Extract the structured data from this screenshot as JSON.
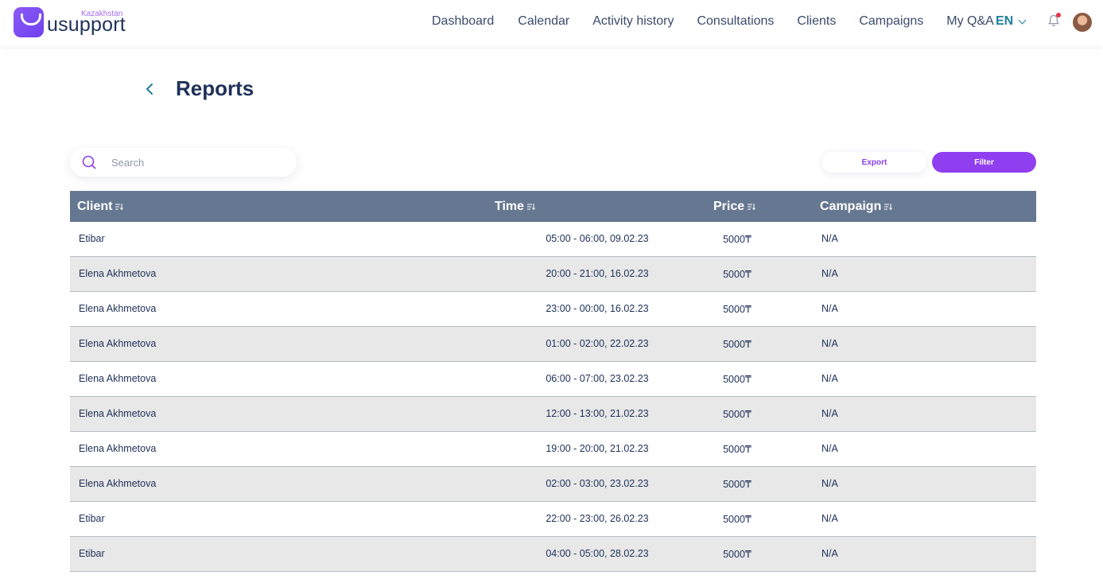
{
  "header": {
    "logo_text": "usupport",
    "region": "Kazakhstan",
    "nav": [
      "Dashboard",
      "Calendar",
      "Activity history",
      "Consultations",
      "Clients",
      "Campaigns",
      "My Q&A"
    ],
    "language": "EN"
  },
  "page": {
    "title": "Reports"
  },
  "toolbar": {
    "search_placeholder": "Search",
    "export_label": "Export",
    "filter_label": "Filter"
  },
  "table": {
    "columns": [
      "Client",
      "Time",
      "Price",
      "Campaign"
    ],
    "rows": [
      [
        "Etibar",
        "05:00 - 06:00, 09.02.23",
        "5000₸",
        "N/A"
      ],
      [
        "Elena Akhmetova",
        "20:00 - 21:00, 16.02.23",
        "5000₸",
        "N/A"
      ],
      [
        "Elena Akhmetova",
        "23:00 - 00:00, 16.02.23",
        "5000₸",
        "N/A"
      ],
      [
        "Elena Akhmetova",
        "01:00 - 02:00, 22.02.23",
        "5000₸",
        "N/A"
      ],
      [
        "Elena Akhmetova",
        "06:00 - 07:00, 23.02.23",
        "5000₸",
        "N/A"
      ],
      [
        "Elena Akhmetova",
        "12:00 - 13:00, 21.02.23",
        "5000₸",
        "N/A"
      ],
      [
        "Elena Akhmetova",
        "19:00 - 20:00, 21.02.23",
        "5000₸",
        "N/A"
      ],
      [
        "Elena Akhmetova",
        "02:00 - 03:00, 23.02.23",
        "5000₸",
        "N/A"
      ],
      [
        "Etibar",
        "22:00 - 23:00, 26.02.23",
        "5000₸",
        "N/A"
      ],
      [
        "Etibar",
        "04:00 - 05:00, 28.02.23",
        "5000₸",
        "N/A"
      ]
    ]
  },
  "colors": {
    "brand_purple": "#8f3ff0",
    "table_header": "#667891",
    "text_dark": "#20325a",
    "accent_teal": "#1e7f9a"
  }
}
